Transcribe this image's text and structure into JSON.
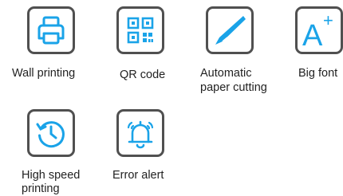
{
  "accent_color": "#1aa3e8",
  "border_color": "#505050",
  "features": [
    {
      "icon": "printer-icon",
      "label": "Wall printing",
      "label_line2": ""
    },
    {
      "icon": "qr-code-icon",
      "label": "QR code",
      "label_line2": ""
    },
    {
      "icon": "cutter-knife-icon",
      "label": "Automatic",
      "label_line2": "paper cutting"
    },
    {
      "icon": "big-font-icon",
      "label": "Big font",
      "label_line2": "",
      "glyph": "A",
      "glyph_sup": "+"
    },
    {
      "icon": "clock-speed-icon",
      "label": "High speed",
      "label_line2": "printing"
    },
    {
      "icon": "alarm-bell-icon",
      "label": "Error alert",
      "label_line2": ""
    }
  ]
}
